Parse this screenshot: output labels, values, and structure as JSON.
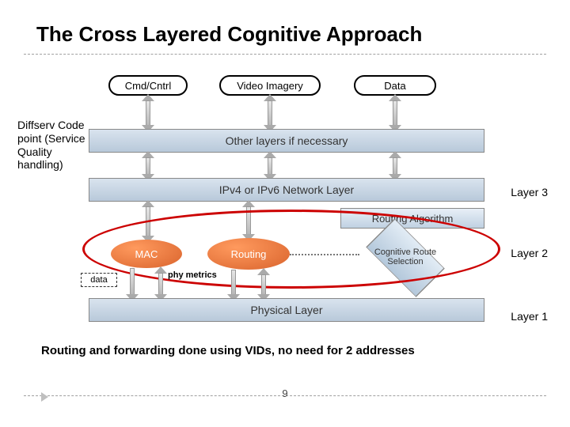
{
  "title": "The Cross Layered Cognitive Approach",
  "sideLabels": {
    "diffserv": "Diffserv Code point (Service Quality handling)",
    "layer3": "Layer 3",
    "layer2": "Layer 2",
    "layer1": "Layer 1"
  },
  "capsules": {
    "cmd": "Cmd/Cntrl",
    "video": "Video Imagery",
    "data": "Data"
  },
  "bars": {
    "other": "Other layers if necessary",
    "ip": "IPv4 or IPv6 Network Layer",
    "physical": "Physical Layer"
  },
  "boxes": {
    "routingAlgo": "Routing Algorithm",
    "mac": "MAC",
    "routing": "Routing",
    "cognitive": "Cognitive Route Selection",
    "dataBox": "data",
    "phyMetrics": "phy metrics"
  },
  "footer": "Routing and forwarding done using VIDs, no need for 2 addresses",
  "pageNumber": "9"
}
